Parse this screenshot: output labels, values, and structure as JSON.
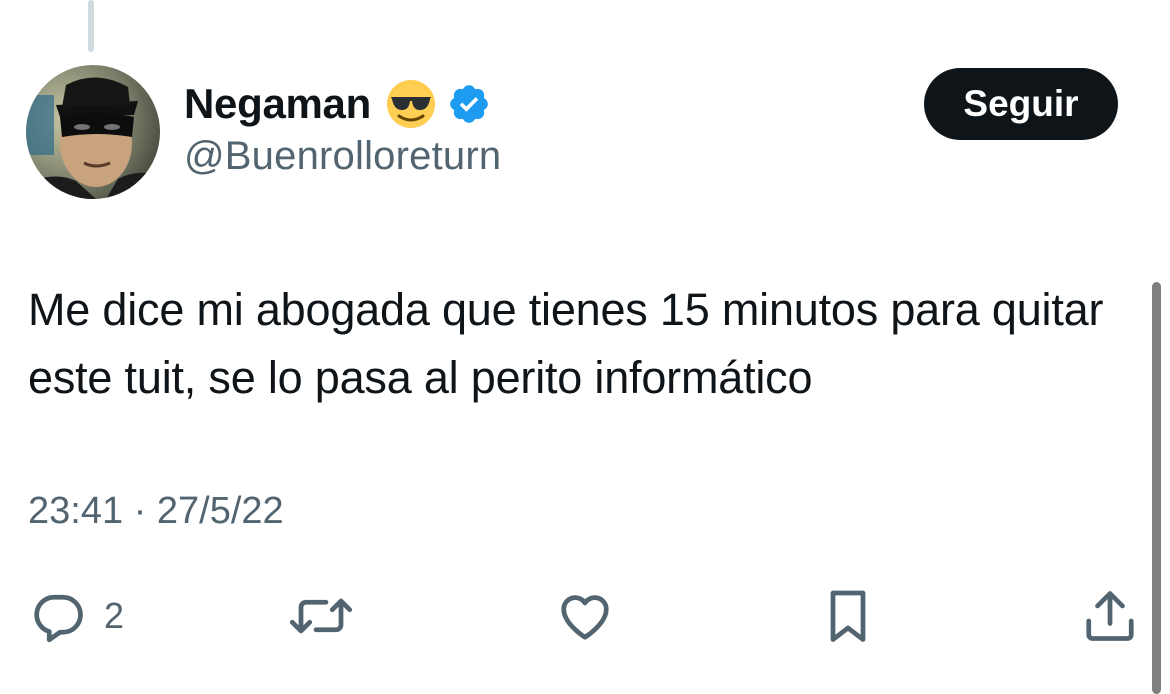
{
  "tweet": {
    "author": {
      "display_name": "Negaman",
      "handle": "@Buenrolloreturn",
      "name_emoji": "sunglasses-emoji",
      "verified": true,
      "verified_color": "#1d9bf0"
    },
    "follow_label": "Seguir",
    "text": "Me dice mi abogada que tienes 15 minutos para quitar este tuit, se lo pasa al perito informático",
    "timestamp": "23:41 · 27/5/22",
    "actions": {
      "reply_count": "2",
      "icons": [
        "reply-icon",
        "retweet-icon",
        "like-icon",
        "bookmark-icon",
        "share-icon"
      ]
    }
  },
  "colors": {
    "text_primary": "#0f1419",
    "text_secondary": "#536471",
    "button_bg": "#0f1419",
    "button_text": "#ffffff"
  }
}
